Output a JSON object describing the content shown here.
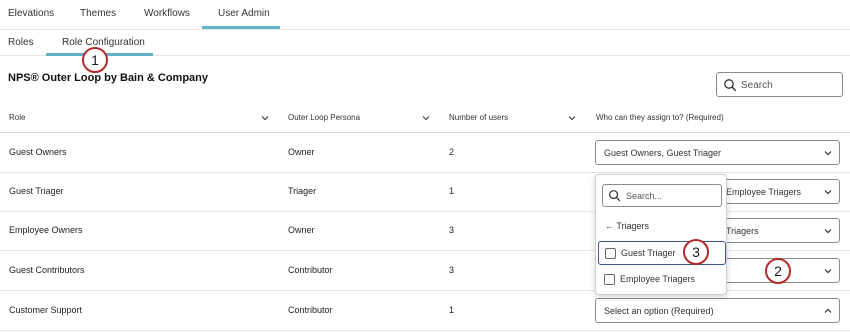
{
  "top_tabs": [
    "Elevations",
    "Themes",
    "Workflows",
    "User Admin"
  ],
  "sub_tabs": [
    "Roles",
    "Role Configuration"
  ],
  "callouts": [
    "1",
    "2",
    "3"
  ],
  "title": "NPS® Outer Loop by Bain & Company",
  "search_placeholder": "Search",
  "columns": [
    "Role",
    "Outer Loop Persona",
    "Number of users",
    "Who can they assign to? (Required)"
  ],
  "rows": [
    {
      "role": "Guest Owners",
      "persona": "Owner",
      "users": "2",
      "assign": "Guest Owners, Guest Triager"
    },
    {
      "role": "Guest Triager",
      "persona": "Triager",
      "users": "1",
      "assign": "Employee Triagers"
    },
    {
      "role": "Employee Owners",
      "persona": "Owner",
      "users": "3",
      "assign": "Triagers"
    },
    {
      "role": "Guest Contributors",
      "persona": "Contributor",
      "users": "3",
      "assign": ""
    },
    {
      "role": "Customer Support",
      "persona": "Contributor",
      "users": "1",
      "assign": "Select an option (Required)"
    }
  ],
  "dropdown": {
    "search_placeholder": "Search...",
    "back_label": "← Triagers",
    "options": [
      "Guest Triager",
      "Employee Triagers"
    ]
  }
}
